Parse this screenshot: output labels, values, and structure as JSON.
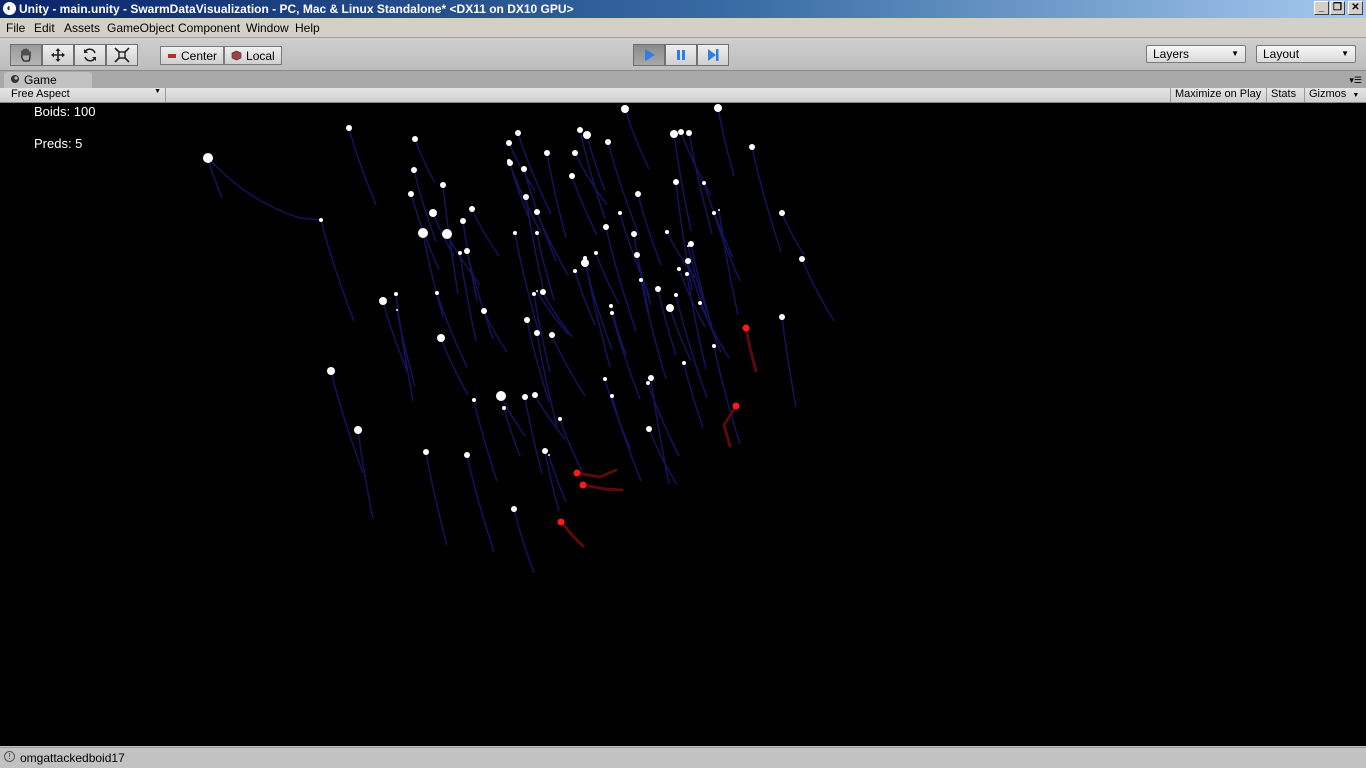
{
  "window": {
    "title": "Unity - main.unity - SwarmDataVisualization - PC, Mac & Linux Standalone* <DX11 on DX10 GPU>",
    "minimize": "_",
    "restore": "❐",
    "close": "✕"
  },
  "menu": {
    "items": [
      "File",
      "Edit",
      "Assets",
      "GameObject",
      "Component",
      "Window",
      "Help"
    ]
  },
  "toolbar": {
    "pivot_label": "Center",
    "space_label": "Local",
    "layers_label": "Layers",
    "layout_label": "Layout"
  },
  "game_tab": {
    "label": "Game",
    "aspect": "Free Aspect",
    "maximize_on_play": "Maximize on Play",
    "stats": "Stats",
    "gizmos": "Gizmos"
  },
  "hud": {
    "boids": "Boids: 100",
    "preds": "Preds: 5"
  },
  "status": {
    "message": "omgattackedboid17"
  },
  "colors": {
    "boid": "#ffffff",
    "predator": "#ff1a1a",
    "boid_trail": "#14145a",
    "pred_trail": "#5a0a0a",
    "viewport_bg": "#000000"
  }
}
